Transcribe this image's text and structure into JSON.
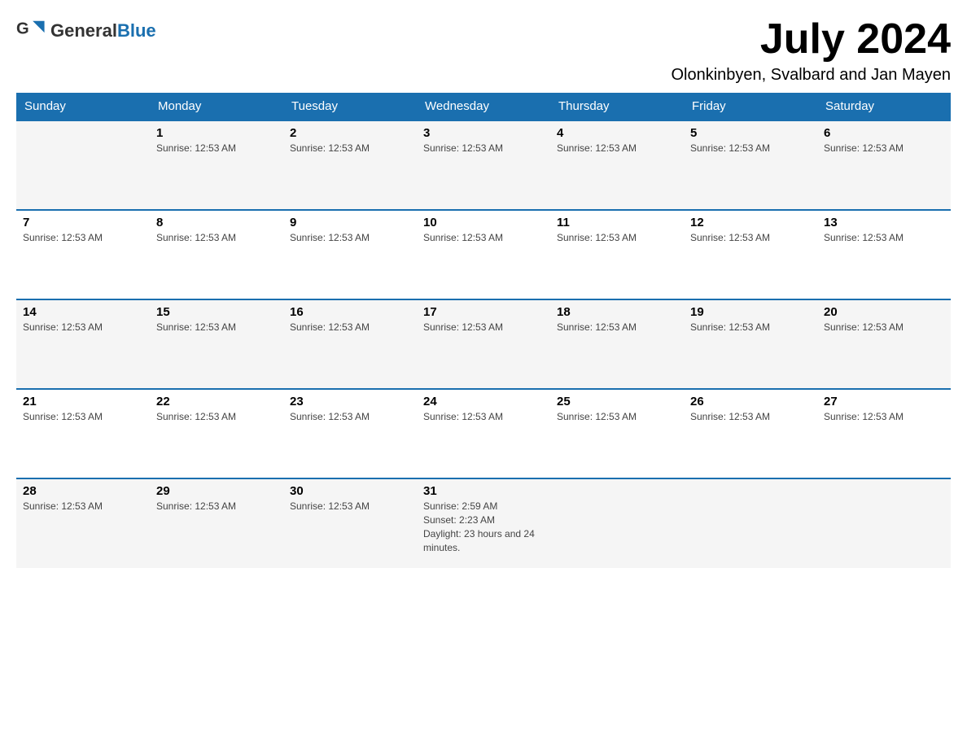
{
  "header": {
    "logo": {
      "text_general": "General",
      "text_blue": "Blue"
    },
    "title": "July 2024",
    "location": "Olonkinbyen, Svalbard and Jan Mayen"
  },
  "calendar": {
    "weekdays": [
      "Sunday",
      "Monday",
      "Tuesday",
      "Wednesday",
      "Thursday",
      "Friday",
      "Saturday"
    ],
    "weeks": [
      [
        {
          "day": "",
          "info": ""
        },
        {
          "day": "1",
          "info": "Sunrise: 12:53 AM"
        },
        {
          "day": "2",
          "info": "Sunrise: 12:53 AM"
        },
        {
          "day": "3",
          "info": "Sunrise: 12:53 AM"
        },
        {
          "day": "4",
          "info": "Sunrise: 12:53 AM"
        },
        {
          "day": "5",
          "info": "Sunrise: 12:53 AM"
        },
        {
          "day": "6",
          "info": "Sunrise: 12:53 AM"
        }
      ],
      [
        {
          "day": "7",
          "info": "Sunrise: 12:53 AM"
        },
        {
          "day": "8",
          "info": "Sunrise: 12:53 AM"
        },
        {
          "day": "9",
          "info": "Sunrise: 12:53 AM"
        },
        {
          "day": "10",
          "info": "Sunrise: 12:53 AM"
        },
        {
          "day": "11",
          "info": "Sunrise: 12:53 AM"
        },
        {
          "day": "12",
          "info": "Sunrise: 12:53 AM"
        },
        {
          "day": "13",
          "info": "Sunrise: 12:53 AM"
        }
      ],
      [
        {
          "day": "14",
          "info": "Sunrise: 12:53 AM"
        },
        {
          "day": "15",
          "info": "Sunrise: 12:53 AM"
        },
        {
          "day": "16",
          "info": "Sunrise: 12:53 AM"
        },
        {
          "day": "17",
          "info": "Sunrise: 12:53 AM"
        },
        {
          "day": "18",
          "info": "Sunrise: 12:53 AM"
        },
        {
          "day": "19",
          "info": "Sunrise: 12:53 AM"
        },
        {
          "day": "20",
          "info": "Sunrise: 12:53 AM"
        }
      ],
      [
        {
          "day": "21",
          "info": "Sunrise: 12:53 AM"
        },
        {
          "day": "22",
          "info": "Sunrise: 12:53 AM"
        },
        {
          "day": "23",
          "info": "Sunrise: 12:53 AM"
        },
        {
          "day": "24",
          "info": "Sunrise: 12:53 AM"
        },
        {
          "day": "25",
          "info": "Sunrise: 12:53 AM"
        },
        {
          "day": "26",
          "info": "Sunrise: 12:53 AM"
        },
        {
          "day": "27",
          "info": "Sunrise: 12:53 AM"
        }
      ],
      [
        {
          "day": "28",
          "info": "Sunrise: 12:53 AM"
        },
        {
          "day": "29",
          "info": "Sunrise: 12:53 AM"
        },
        {
          "day": "30",
          "info": "Sunrise: 12:53 AM"
        },
        {
          "day": "31",
          "info": "Sunrise: 2:59 AM\nSunset: 2:23 AM\nDaylight: 23 hours and 24 minutes."
        },
        {
          "day": "",
          "info": ""
        },
        {
          "day": "",
          "info": ""
        },
        {
          "day": "",
          "info": ""
        }
      ]
    ]
  }
}
